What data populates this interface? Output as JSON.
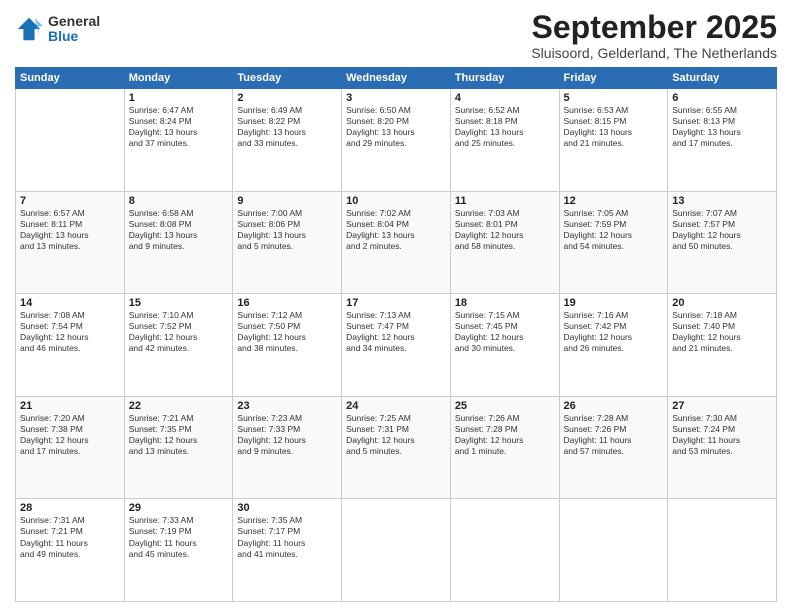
{
  "header": {
    "logo": {
      "general": "General",
      "blue": "Blue"
    },
    "title": "September 2025",
    "subtitle": "Sluisoord, Gelderland, The Netherlands"
  },
  "weekdays": [
    "Sunday",
    "Monday",
    "Tuesday",
    "Wednesday",
    "Thursday",
    "Friday",
    "Saturday"
  ],
  "weeks": [
    [
      {
        "day": "",
        "info": ""
      },
      {
        "day": "1",
        "info": "Sunrise: 6:47 AM\nSunset: 8:24 PM\nDaylight: 13 hours\nand 37 minutes."
      },
      {
        "day": "2",
        "info": "Sunrise: 6:49 AM\nSunset: 8:22 PM\nDaylight: 13 hours\nand 33 minutes."
      },
      {
        "day": "3",
        "info": "Sunrise: 6:50 AM\nSunset: 8:20 PM\nDaylight: 13 hours\nand 29 minutes."
      },
      {
        "day": "4",
        "info": "Sunrise: 6:52 AM\nSunset: 8:18 PM\nDaylight: 13 hours\nand 25 minutes."
      },
      {
        "day": "5",
        "info": "Sunrise: 6:53 AM\nSunset: 8:15 PM\nDaylight: 13 hours\nand 21 minutes."
      },
      {
        "day": "6",
        "info": "Sunrise: 6:55 AM\nSunset: 8:13 PM\nDaylight: 13 hours\nand 17 minutes."
      }
    ],
    [
      {
        "day": "7",
        "info": "Sunrise: 6:57 AM\nSunset: 8:11 PM\nDaylight: 13 hours\nand 13 minutes."
      },
      {
        "day": "8",
        "info": "Sunrise: 6:58 AM\nSunset: 8:08 PM\nDaylight: 13 hours\nand 9 minutes."
      },
      {
        "day": "9",
        "info": "Sunrise: 7:00 AM\nSunset: 8:06 PM\nDaylight: 13 hours\nand 5 minutes."
      },
      {
        "day": "10",
        "info": "Sunrise: 7:02 AM\nSunset: 8:04 PM\nDaylight: 13 hours\nand 2 minutes."
      },
      {
        "day": "11",
        "info": "Sunrise: 7:03 AM\nSunset: 8:01 PM\nDaylight: 12 hours\nand 58 minutes."
      },
      {
        "day": "12",
        "info": "Sunrise: 7:05 AM\nSunset: 7:59 PM\nDaylight: 12 hours\nand 54 minutes."
      },
      {
        "day": "13",
        "info": "Sunrise: 7:07 AM\nSunset: 7:57 PM\nDaylight: 12 hours\nand 50 minutes."
      }
    ],
    [
      {
        "day": "14",
        "info": "Sunrise: 7:08 AM\nSunset: 7:54 PM\nDaylight: 12 hours\nand 46 minutes."
      },
      {
        "day": "15",
        "info": "Sunrise: 7:10 AM\nSunset: 7:52 PM\nDaylight: 12 hours\nand 42 minutes."
      },
      {
        "day": "16",
        "info": "Sunrise: 7:12 AM\nSunset: 7:50 PM\nDaylight: 12 hours\nand 38 minutes."
      },
      {
        "day": "17",
        "info": "Sunrise: 7:13 AM\nSunset: 7:47 PM\nDaylight: 12 hours\nand 34 minutes."
      },
      {
        "day": "18",
        "info": "Sunrise: 7:15 AM\nSunset: 7:45 PM\nDaylight: 12 hours\nand 30 minutes."
      },
      {
        "day": "19",
        "info": "Sunrise: 7:16 AM\nSunset: 7:42 PM\nDaylight: 12 hours\nand 26 minutes."
      },
      {
        "day": "20",
        "info": "Sunrise: 7:18 AM\nSunset: 7:40 PM\nDaylight: 12 hours\nand 21 minutes."
      }
    ],
    [
      {
        "day": "21",
        "info": "Sunrise: 7:20 AM\nSunset: 7:38 PM\nDaylight: 12 hours\nand 17 minutes."
      },
      {
        "day": "22",
        "info": "Sunrise: 7:21 AM\nSunset: 7:35 PM\nDaylight: 12 hours\nand 13 minutes."
      },
      {
        "day": "23",
        "info": "Sunrise: 7:23 AM\nSunset: 7:33 PM\nDaylight: 12 hours\nand 9 minutes."
      },
      {
        "day": "24",
        "info": "Sunrise: 7:25 AM\nSunset: 7:31 PM\nDaylight: 12 hours\nand 5 minutes."
      },
      {
        "day": "25",
        "info": "Sunrise: 7:26 AM\nSunset: 7:28 PM\nDaylight: 12 hours\nand 1 minute."
      },
      {
        "day": "26",
        "info": "Sunrise: 7:28 AM\nSunset: 7:26 PM\nDaylight: 11 hours\nand 57 minutes."
      },
      {
        "day": "27",
        "info": "Sunrise: 7:30 AM\nSunset: 7:24 PM\nDaylight: 11 hours\nand 53 minutes."
      }
    ],
    [
      {
        "day": "28",
        "info": "Sunrise: 7:31 AM\nSunset: 7:21 PM\nDaylight: 11 hours\nand 49 minutes."
      },
      {
        "day": "29",
        "info": "Sunrise: 7:33 AM\nSunset: 7:19 PM\nDaylight: 11 hours\nand 45 minutes."
      },
      {
        "day": "30",
        "info": "Sunrise: 7:35 AM\nSunset: 7:17 PM\nDaylight: 11 hours\nand 41 minutes."
      },
      {
        "day": "",
        "info": ""
      },
      {
        "day": "",
        "info": ""
      },
      {
        "day": "",
        "info": ""
      },
      {
        "day": "",
        "info": ""
      }
    ]
  ]
}
